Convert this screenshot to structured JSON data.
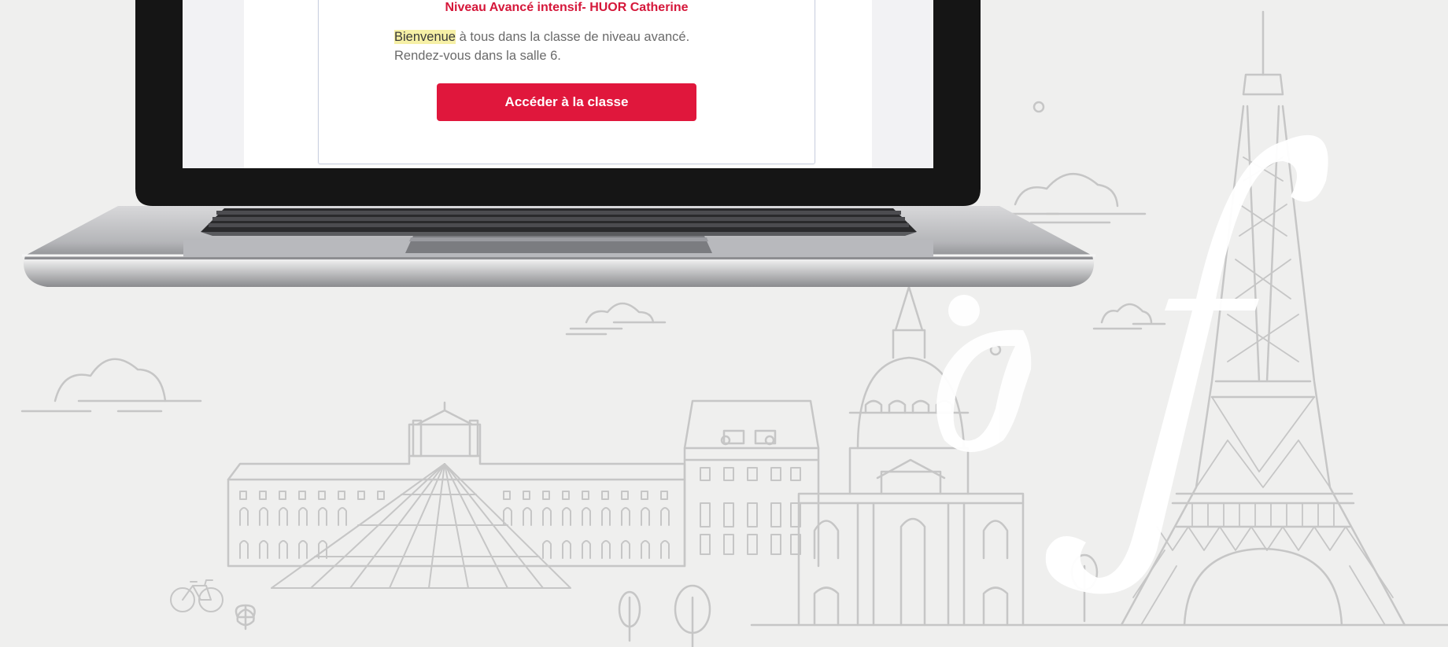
{
  "class_card": {
    "title": "Niveau Avancé intensif- HUOR Catherine",
    "welcome_highlight": "Bienvenue",
    "welcome_rest": " à tous dans la classe de niveau avancé.",
    "welcome_line2": "Rendez-vous dans la salle 6.",
    "button_label": "Accéder à la classe"
  },
  "colors": {
    "accent_red": "#e0173c",
    "title_red": "#d5173a",
    "background": "#efefee",
    "line_art": "#c4c4c4"
  },
  "decor": {
    "logo": "af-alliance-francaise-logo",
    "illustration": "paris-skyline-line-art"
  }
}
